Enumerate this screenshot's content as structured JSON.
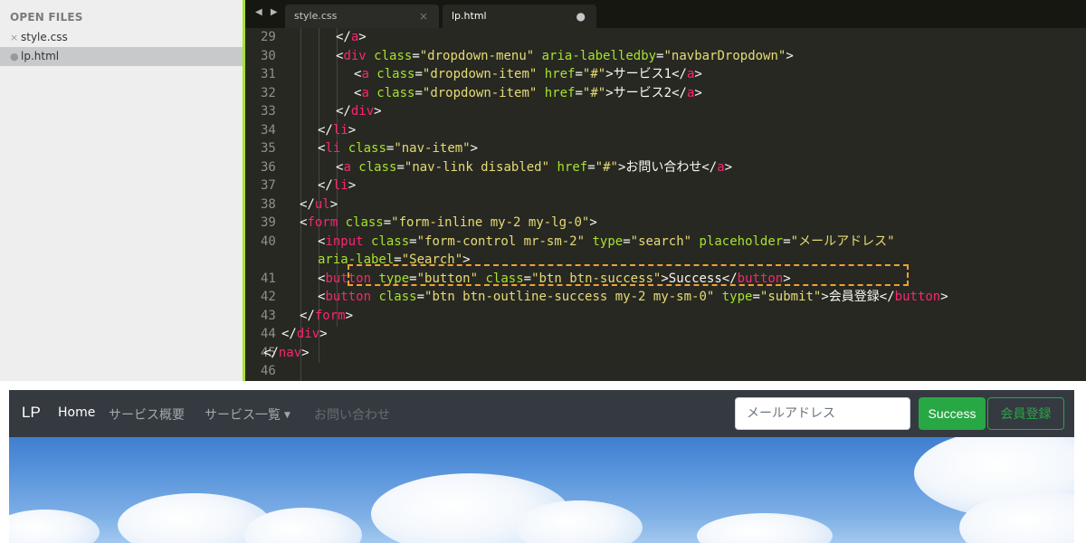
{
  "sidebar": {
    "header": "OPEN FILES",
    "files": [
      {
        "mark": "×",
        "name": "style.css",
        "active": false
      },
      {
        "mark": "●",
        "name": "lp.html",
        "active": true
      }
    ]
  },
  "tabs": {
    "arrows": "◀ ▶",
    "items": [
      {
        "label": "style.css",
        "state": "×"
      },
      {
        "label": "lp.html",
        "state": "●"
      }
    ]
  },
  "code": {
    "line_numbers": [
      "29",
      "30",
      "31",
      "32",
      "33",
      "34",
      "35",
      "36",
      "37",
      "38",
      "39",
      "40",
      "",
      "41",
      "42",
      "43",
      "44",
      "45",
      "46"
    ],
    "lines": [
      [
        {
          "c": "p",
          "t": "</"
        },
        {
          "c": "t",
          "t": "a"
        },
        {
          "c": "p",
          "t": ">"
        }
      ],
      [
        {
          "c": "p",
          "t": "<"
        },
        {
          "c": "t",
          "t": "div"
        },
        {
          "c": "a",
          "t": " class"
        },
        {
          "c": "p",
          "t": "="
        },
        {
          "c": "s",
          "t": "\"dropdown-menu\""
        },
        {
          "c": "a",
          "t": " aria-labelledby"
        },
        {
          "c": "p",
          "t": "="
        },
        {
          "c": "s",
          "t": "\"navbarDropdown\""
        },
        {
          "c": "p",
          "t": ">"
        }
      ],
      [
        {
          "c": "p",
          "t": "<"
        },
        {
          "c": "t",
          "t": "a"
        },
        {
          "c": "a",
          "t": " class"
        },
        {
          "c": "p",
          "t": "="
        },
        {
          "c": "s",
          "t": "\"dropdown-item\""
        },
        {
          "c": "a",
          "t": " href"
        },
        {
          "c": "p",
          "t": "="
        },
        {
          "c": "s",
          "t": "\"#\""
        },
        {
          "c": "p",
          "t": ">サービス1</"
        },
        {
          "c": "t",
          "t": "a"
        },
        {
          "c": "p",
          "t": ">"
        }
      ],
      [
        {
          "c": "p",
          "t": "<"
        },
        {
          "c": "t",
          "t": "a"
        },
        {
          "c": "a",
          "t": " class"
        },
        {
          "c": "p",
          "t": "="
        },
        {
          "c": "s",
          "t": "\"dropdown-item\""
        },
        {
          "c": "a",
          "t": " href"
        },
        {
          "c": "p",
          "t": "="
        },
        {
          "c": "s",
          "t": "\"#\""
        },
        {
          "c": "p",
          "t": ">サービス2</"
        },
        {
          "c": "t",
          "t": "a"
        },
        {
          "c": "p",
          "t": ">"
        }
      ],
      [
        {
          "c": "p",
          "t": "</"
        },
        {
          "c": "t",
          "t": "div"
        },
        {
          "c": "p",
          "t": ">"
        }
      ],
      [
        {
          "c": "p",
          "t": "</"
        },
        {
          "c": "t",
          "t": "li"
        },
        {
          "c": "p",
          "t": ">"
        }
      ],
      [
        {
          "c": "p",
          "t": "<"
        },
        {
          "c": "t",
          "t": "li"
        },
        {
          "c": "a",
          "t": " class"
        },
        {
          "c": "p",
          "t": "="
        },
        {
          "c": "s",
          "t": "\"nav-item\""
        },
        {
          "c": "p",
          "t": ">"
        }
      ],
      [
        {
          "c": "p",
          "t": "<"
        },
        {
          "c": "t",
          "t": "a"
        },
        {
          "c": "a",
          "t": " class"
        },
        {
          "c": "p",
          "t": "="
        },
        {
          "c": "s",
          "t": "\"nav-link disabled\""
        },
        {
          "c": "a",
          "t": " href"
        },
        {
          "c": "p",
          "t": "="
        },
        {
          "c": "s",
          "t": "\"#\""
        },
        {
          "c": "p",
          "t": ">お問い合わせ</"
        },
        {
          "c": "t",
          "t": "a"
        },
        {
          "c": "p",
          "t": ">"
        }
      ],
      [
        {
          "c": "p",
          "t": "</"
        },
        {
          "c": "t",
          "t": "li"
        },
        {
          "c": "p",
          "t": ">"
        }
      ],
      [
        {
          "c": "p",
          "t": "</"
        },
        {
          "c": "t",
          "t": "ul"
        },
        {
          "c": "p",
          "t": ">"
        }
      ],
      [
        {
          "c": "p",
          "t": "<"
        },
        {
          "c": "t",
          "t": "form"
        },
        {
          "c": "a",
          "t": " class"
        },
        {
          "c": "p",
          "t": "="
        },
        {
          "c": "s",
          "t": "\"form-inline my-2 my-lg-0\""
        },
        {
          "c": "p",
          "t": ">"
        }
      ],
      [
        {
          "c": "p",
          "t": "<"
        },
        {
          "c": "t",
          "t": "input"
        },
        {
          "c": "a",
          "t": " class"
        },
        {
          "c": "p",
          "t": "="
        },
        {
          "c": "s",
          "t": "\"form-control mr-sm-2\""
        },
        {
          "c": "a",
          "t": " type"
        },
        {
          "c": "p",
          "t": "="
        },
        {
          "c": "s",
          "t": "\"search\""
        },
        {
          "c": "a",
          "t": " placeholder"
        },
        {
          "c": "p",
          "t": "="
        },
        {
          "c": "s",
          "t": "\"メールアドレス\""
        }
      ],
      [
        {
          "c": "a",
          "t": "aria-label"
        },
        {
          "c": "p",
          "t": "="
        },
        {
          "c": "s",
          "t": "\"Search\""
        },
        {
          "c": "p",
          "t": ">"
        }
      ],
      [
        {
          "c": "p",
          "t": "<"
        },
        {
          "c": "t",
          "t": "button"
        },
        {
          "c": "a",
          "t": " type"
        },
        {
          "c": "p",
          "t": "="
        },
        {
          "c": "s",
          "t": "\"button\""
        },
        {
          "c": "a",
          "t": " class"
        },
        {
          "c": "p",
          "t": "="
        },
        {
          "c": "s",
          "t": "\"btn btn-success\""
        },
        {
          "c": "p",
          "t": ">Success</"
        },
        {
          "c": "t",
          "t": "button"
        },
        {
          "c": "p",
          "t": ">"
        }
      ],
      [
        {
          "c": "p",
          "t": "<"
        },
        {
          "c": "t",
          "t": "button"
        },
        {
          "c": "a",
          "t": " class"
        },
        {
          "c": "p",
          "t": "="
        },
        {
          "c": "s",
          "t": "\"btn btn-outline-success my-2 my-sm-0\""
        },
        {
          "c": "a",
          "t": " type"
        },
        {
          "c": "p",
          "t": "="
        },
        {
          "c": "s",
          "t": "\"submit\""
        },
        {
          "c": "p",
          "t": ">会員登録</"
        },
        {
          "c": "t",
          "t": "button"
        },
        {
          "c": "p",
          "t": ">"
        }
      ],
      [
        {
          "c": "p",
          "t": "</"
        },
        {
          "c": "t",
          "t": "form"
        },
        {
          "c": "p",
          "t": ">"
        }
      ],
      [
        {
          "c": "p",
          "t": "</"
        },
        {
          "c": "t",
          "t": "div"
        },
        {
          "c": "p",
          "t": ">"
        }
      ],
      [
        {
          "c": "p",
          "t": "</"
        },
        {
          "c": "t",
          "t": "nav"
        },
        {
          "c": "p",
          "t": ">"
        }
      ],
      []
    ],
    "highlighted_line": "41"
  },
  "navbar": {
    "brand": "LP",
    "links": [
      "Home",
      "サービス概要",
      "サービス一覧",
      "お問い合わせ"
    ],
    "dropdown_caret": "▼",
    "search_placeholder": "メールアドレス",
    "success_label": "Success",
    "register_label": "会員登録"
  },
  "colors": {
    "editor_bg": "#272822",
    "tag": "#f92672",
    "attribute": "#a6e22e",
    "string": "#e6db74",
    "navbar_bg": "#343a40",
    "success": "#28a745",
    "highlight_box": "#f0a030"
  }
}
